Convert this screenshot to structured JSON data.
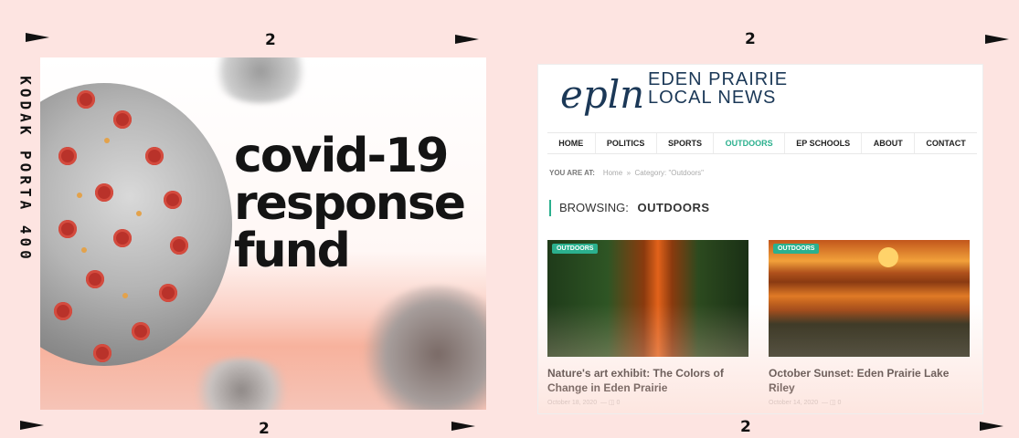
{
  "film": {
    "frame_number": "2",
    "brand_text": "KODAK PORTA 400"
  },
  "covid_card": {
    "title_line1": "covid-19",
    "title_line2": "response",
    "title_line3": "fund",
    "accent_color": "#b9322a"
  },
  "website": {
    "logo_script": "epln",
    "logo_line1": "EDEN PRAIRIE",
    "logo_line2": "LOCAL NEWS",
    "nav": [
      "HOME",
      "POLITICS",
      "SPORTS",
      "OUTDOORS",
      "EP SCHOOLS",
      "ABOUT",
      "CONTACT"
    ],
    "active_nav": "OUTDOORS",
    "breadcrumb": {
      "prefix": "YOU ARE AT:",
      "home": "Home",
      "separator": "»",
      "current": "Category: \"Outdoors\""
    },
    "browsing_label": "BROWSING:",
    "browsing_value": "OUTDOORS",
    "accent_color": "#2bb08e",
    "articles": [
      {
        "tag": "OUTDOORS",
        "title": "Nature's art exhibit: The Colors of Change in Eden Prairie",
        "date": "October 18, 2020",
        "comments": "0"
      },
      {
        "tag": "OUTDOORS",
        "title": "October Sunset: Eden Prairie Lake Riley",
        "date": "October 14, 2020",
        "comments": "0"
      }
    ]
  }
}
